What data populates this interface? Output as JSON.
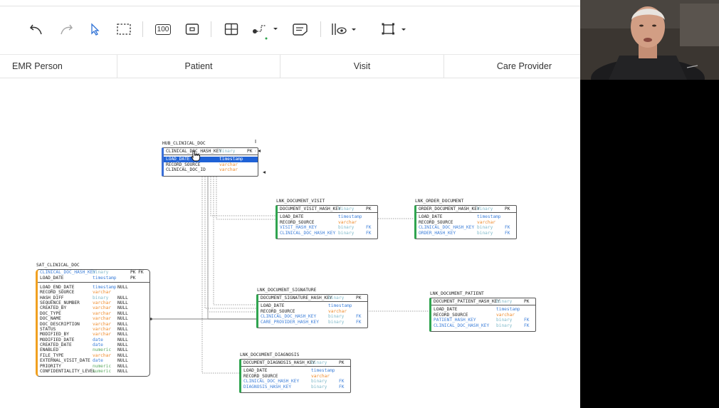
{
  "toolbar": {
    "tools": [
      {
        "id": "undo",
        "icon": "undo-icon"
      },
      {
        "id": "redo",
        "icon": "redo-icon"
      },
      {
        "id": "select",
        "icon": "pointer-icon"
      },
      {
        "id": "marquee",
        "icon": "marquee-select-icon"
      },
      {
        "id": "sample",
        "icon": "sample-data-icon",
        "label": "100"
      },
      {
        "id": "note",
        "icon": "note-box-icon"
      },
      {
        "id": "table",
        "icon": "table-grid-icon"
      },
      {
        "id": "line",
        "icon": "line-style-icon"
      },
      {
        "id": "comment",
        "icon": "comment-icon"
      },
      {
        "id": "display",
        "icon": "display-mode-icon"
      },
      {
        "id": "fit",
        "icon": "fit-screen-icon"
      }
    ]
  },
  "lanes": [
    "EMR Person",
    "Patient",
    "Visit",
    "Care Provider"
  ],
  "tables": {
    "hub_clinical_doc": {
      "name": "HUB_CLINICAL_DOC",
      "header": {
        "col": "CLINICAL_DOC_HASH_KEY",
        "type": "binary",
        "key": "PK"
      },
      "rows": [
        {
          "col": "LOAD_DATE",
          "type": "timestamp",
          "selected": true
        },
        {
          "col": "RECORD_SOURCE",
          "type": "varchar"
        },
        {
          "col": "CLINICAL_DOC_ID",
          "type": "varchar"
        }
      ]
    },
    "lnk_document_visit": {
      "name": "LNK_DOCUMENT_VISIT",
      "header": {
        "col": "DOCUMENT_VISIT_HASH_KEY",
        "type": "binary",
        "key": "PK"
      },
      "rows": [
        {
          "col": "LOAD_DATE",
          "type": "timestamp"
        },
        {
          "col": "RECORD_SOURCE",
          "type": "varchar"
        },
        {
          "col": "VISIT_HASH_KEY",
          "type": "binary",
          "key": "FK"
        },
        {
          "col": "CLINICAL_DOC_HASH_KEY",
          "type": "binary",
          "key": "FK"
        }
      ]
    },
    "lnk_order_document": {
      "name": "LNK_ORDER_DOCUMENT",
      "header": {
        "col": "ORDER_DOCUMENT_HASH_KEY",
        "type": "binary",
        "key": "PK"
      },
      "rows": [
        {
          "col": "LOAD_DATE",
          "type": "timestamp"
        },
        {
          "col": "RECORD_SOURCE",
          "type": "varchar"
        },
        {
          "col": "CLINICAL_DOC_HASH_KEY",
          "type": "binary",
          "key": "FK"
        },
        {
          "col": "ORDER_HASH_KEY",
          "type": "binary",
          "key": "FK"
        }
      ]
    },
    "sat_clinical_doc": {
      "name": "SAT_CLINICAL_DOC",
      "pk_rows": [
        {
          "col": "CLINICAL_DOC_HASH_KEY",
          "type": "binary",
          "key": "PK FK"
        },
        {
          "col": "LOAD_DATE",
          "type": "timestamp",
          "key": "PK"
        }
      ],
      "rows": [
        {
          "col": "LOAD_END_DATE",
          "type": "timestamp",
          "null": "NULL"
        },
        {
          "col": "RECORD_SOURCE",
          "type": "varchar"
        },
        {
          "col": "HASH_DIFF",
          "type": "binary",
          "null": "NULL"
        },
        {
          "col": "SEQUENCE_NUMBER",
          "type": "varchar",
          "null": "NULL"
        },
        {
          "col": "CREATED_BY",
          "type": "varchar",
          "null": "NULL"
        },
        {
          "col": "DOC_TYPE",
          "type": "varchar",
          "null": "NULL"
        },
        {
          "col": "DOC_NAME",
          "type": "varchar",
          "null": "NULL"
        },
        {
          "col": "DOC_DESCRIPTION",
          "type": "varchar",
          "null": "NULL"
        },
        {
          "col": "STATUS",
          "type": "varchar",
          "null": "NULL"
        },
        {
          "col": "MODIFIED_BY",
          "type": "varchar",
          "null": "NULL"
        },
        {
          "col": "MODIFIED_DATE",
          "type": "date",
          "null": "NULL"
        },
        {
          "col": "CREATED_DATE",
          "type": "date",
          "null": "NULL"
        },
        {
          "col": "ENABLED",
          "type": "numeric",
          "null": "NULL"
        },
        {
          "col": "FILE_TYPE",
          "type": "varchar",
          "null": "NULL"
        },
        {
          "col": "EXTERNAL_VISIT_DATE",
          "type": "date",
          "null": "NULL"
        },
        {
          "col": "PRIORITY",
          "type": "numeric",
          "null": "NULL"
        },
        {
          "col": "CONFIDENTIALITY_LEVEL",
          "type": "numeric",
          "null": "NULL"
        }
      ]
    },
    "lnk_document_signature": {
      "name": "LNK_DOCUMENT_SIGNATURE",
      "header": {
        "col": "DOCUMENT_SIGNATURE_HASH_KEY",
        "type": "binary",
        "key": "PK"
      },
      "rows": [
        {
          "col": "LOAD_DATE",
          "type": "timestamp"
        },
        {
          "col": "RECORD_SOURCE",
          "type": "varchar"
        },
        {
          "col": "CLINICAL_DOC_HASH_KEY",
          "type": "binary",
          "key": "FK"
        },
        {
          "col": "CARE_PROVIDER_HASH_KEY",
          "type": "binary",
          "key": "FK"
        }
      ]
    },
    "lnk_document_patient": {
      "name": "LNK_DOCUMENT_PATIENT",
      "header": {
        "col": "DOCUMENT_PATIENT_HASH_KEY",
        "type": "binary",
        "key": "PK"
      },
      "rows": [
        {
          "col": "LOAD_DATE",
          "type": "timestamp"
        },
        {
          "col": "RECORD_SOURCE",
          "type": "varchar"
        },
        {
          "col": "PATIENT_HASH_KEY",
          "type": "binary",
          "key": "FK"
        },
        {
          "col": "CLINICAL_DOC_HASH_KEY",
          "type": "binary",
          "key": "FK"
        }
      ]
    },
    "lnk_document_diagnosis": {
      "name": "LNK_DOCUMENT_DIAGNOSIS",
      "header": {
        "col": "DOCUMENT_DIAGNOSIS_HASH_KEY",
        "type": "binary",
        "key": "PK"
      },
      "rows": [
        {
          "col": "LOAD_DATE",
          "type": "timestamp"
        },
        {
          "col": "RECORD_SOURCE",
          "type": "varchar"
        },
        {
          "col": "CLINICAL_DOC_HASH_KEY",
          "type": "binary",
          "key": "FK"
        },
        {
          "col": "DIAGNOSIS_HASH_KEY",
          "type": "binary",
          "key": "FK"
        }
      ]
    }
  },
  "colors": {
    "hub_accent": "#3a6fd8",
    "link_accent": "#2fa44f",
    "sat_accent": "#f0a020",
    "selection": "#1f62d6"
  }
}
